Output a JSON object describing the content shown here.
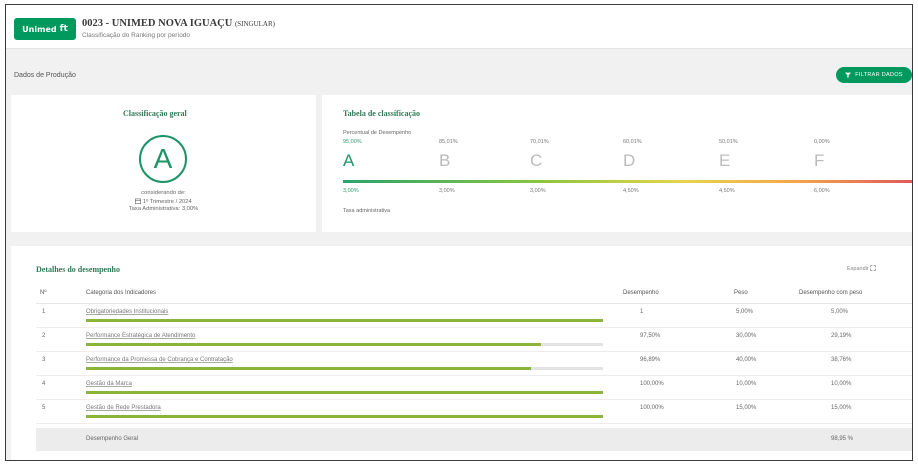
{
  "header": {
    "logo_text": "Unimed",
    "logo_mark": "ft",
    "title": "0023 - UNIMED NOVA IGUAÇU",
    "title_suffix": "(SINGULAR)",
    "subtitle": "Classificação do Ranking por período"
  },
  "section_label": "Dados de Produção",
  "filter_button": {
    "icon": "filter-icon",
    "label": "FILTRAR DADOS"
  },
  "classificacao": {
    "title": "Classificação geral",
    "grade": "A",
    "line1": "considerando de:",
    "period": "1º Trimestre / 2024",
    "calendar_icon": "calendar-icon",
    "taxa": "Taxa Administrativa: 3,00%"
  },
  "tabela": {
    "title": "Tabela de classificação",
    "percentual_label": "Percentual de Desempenho",
    "grades": [
      {
        "top": "95,00%",
        "letter": "A",
        "bottom": "3,00%"
      },
      {
        "top": "85,01%",
        "letter": "B",
        "bottom": "3,00%"
      },
      {
        "top": "70,01%",
        "letter": "C",
        "bottom": "3,00%"
      },
      {
        "top": "60,01%",
        "letter": "D",
        "bottom": "4,50%"
      },
      {
        "top": "50,01%",
        "letter": "E",
        "bottom": "4,50%"
      },
      {
        "top": "0,00%",
        "letter": "F",
        "bottom": "6,00%"
      }
    ],
    "taxa_label": "Taxa administrativa"
  },
  "detalhes": {
    "title": "Detalhes do desempenho",
    "expand_label": "Expandir",
    "expand_icon": "expand-icon",
    "columns": [
      "Nº",
      "Categoria dos Indicadores",
      "Desempenho",
      "Peso",
      "Desempenho com peso"
    ],
    "rows": [
      {
        "n": "1",
        "categoria": "Obrigatoriedades Institucionais",
        "desempenho": "1",
        "peso": "5,00%",
        "com_peso": "5,00%",
        "progress": 1.0
      },
      {
        "n": "2",
        "categoria": "Performance Estratégica de Atendimento",
        "desempenho": "97,50%",
        "peso": "30,00%",
        "com_peso": "29,19%",
        "progress": 0.88
      },
      {
        "n": "3",
        "categoria": "Performance da Promessa de Cobrança e Contratação",
        "desempenho": "96,89%",
        "peso": "40,00%",
        "com_peso": "38,76%",
        "progress": 0.86
      },
      {
        "n": "4",
        "categoria": "Gestão da Marca",
        "desempenho": "100,00%",
        "peso": "10,00%",
        "com_peso": "10,00%",
        "progress": 1.0
      },
      {
        "n": "5",
        "categoria": "Gestão de Rede Prestadora",
        "desempenho": "100,00%",
        "peso": "15,00%",
        "com_peso": "15,00%",
        "progress": 1.0
      }
    ],
    "total_label": "Desempenho Geral",
    "total_value": "98,95 %"
  },
  "colors": {
    "primary": "#00995d",
    "progress": "#8cb33a"
  }
}
